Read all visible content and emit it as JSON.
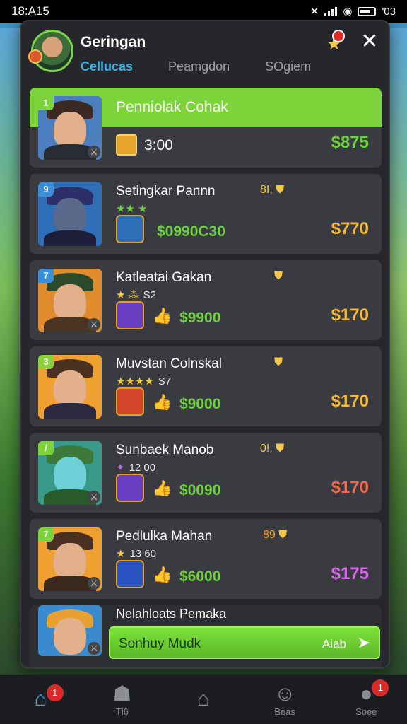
{
  "status": {
    "time": "18:A15",
    "right_text": "'03"
  },
  "header": {
    "title": "Geringan",
    "tabs": [
      "Cellucas",
      "Peamgdon",
      "SOgiem"
    ],
    "active_tab": 0,
    "trophy_badge": "0"
  },
  "rows": [
    {
      "title": "Penniolak Cohak",
      "timer": "3:00",
      "price": "$875",
      "price_color": "#6cd33c",
      "level": "1",
      "colors": {
        "bg": "#4b7fc0",
        "hat": "#3b2a24",
        "body": "#2a2c35",
        "level_bg": "#7cd33a",
        "icon": "#e7a52c"
      }
    },
    {
      "title": "Setingkar Pannn",
      "badge": "8I,",
      "stars": "★★ ★",
      "stars_val": "",
      "item_value": "$0990C30",
      "price": "$770",
      "price_color": "#f4b93a",
      "level": "9",
      "colors": {
        "bg": "#2f6fb8",
        "hat": "#2c2f6a",
        "body": "#1d1f3a",
        "level_bg": "#3b8fd8",
        "icon": "#2c6fb8"
      }
    },
    {
      "title": "Katleatai Gakan",
      "badge": "",
      "stars": "★ ⁂",
      "stars_val": "S2",
      "item_value": "$9900",
      "price": "$170",
      "price_color": "#f4b93a",
      "level": "7",
      "colors": {
        "bg": "#e08b2c",
        "hat": "#2c4a2a",
        "body": "#4a3424",
        "level_bg": "#3b8fd8",
        "icon": "#6a3ec0"
      }
    },
    {
      "title": "Muvstan Colnskal",
      "badge": "",
      "stars": "★★★★",
      "stars_val": "S7",
      "item_value": "$9000",
      "price": "$170",
      "price_color": "#f4b93a",
      "level": "3",
      "colors": {
        "bg": "#f0a030",
        "hat": "#4a3020",
        "body": "#2d2a40",
        "level_bg": "#8ccf3a",
        "icon": "#d2452a"
      }
    },
    {
      "title": "Sunbaek Manob",
      "badge": "0!,",
      "stars": "✦",
      "stars_val": "12 00",
      "item_value": "$0090",
      "price": "$170",
      "price_color": "#f06a4a",
      "level": "/",
      "colors": {
        "bg": "#3a9a8a",
        "hat": "#3d7a3a",
        "body": "#2a5a2a",
        "level_bg": "#7cd33a",
        "icon": "#6a3ec0"
      }
    },
    {
      "title": "Pedlulka Mahan",
      "badge": "89",
      "stars": "★",
      "stars_val": "13 60",
      "item_value": "$6000",
      "price": "$175",
      "price_color": "#d46ae8",
      "level": "7",
      "colors": {
        "bg": "#f0a030",
        "hat": "#4a3020",
        "body": "#3a2a1e",
        "level_bg": "#7cd33a",
        "icon": "#2a52c0"
      }
    }
  ],
  "last": {
    "title": "Nelahloats Pemaka",
    "action_label": "Sonhuy Mudk",
    "action_right": "Aiab",
    "bg": "#3a8ad0"
  },
  "nav": [
    {
      "label": "",
      "icon": "home-icon",
      "glyph": "⌂",
      "badge": "1"
    },
    {
      "label": "Tl6",
      "icon": "people-icon",
      "glyph": "☗",
      "badge": ""
    },
    {
      "label": "",
      "icon": "house-outline-icon",
      "glyph": "⌂",
      "badge": ""
    },
    {
      "label": "Beas",
      "icon": "profile-icon",
      "glyph": "☺",
      "badge": ""
    },
    {
      "label": "Soee",
      "icon": "user-icon",
      "glyph": "●",
      "badge": "1"
    }
  ]
}
